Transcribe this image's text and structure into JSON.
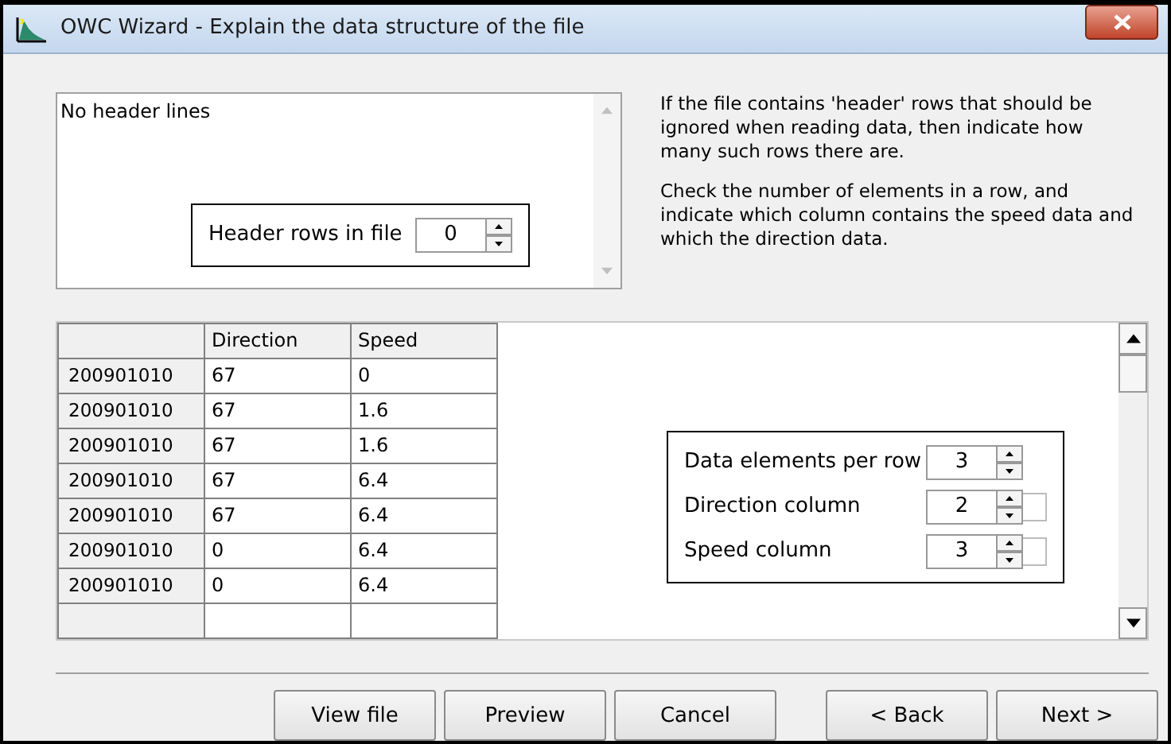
{
  "window": {
    "title": "OWC Wizard - Explain the data structure of the file"
  },
  "header_memo": {
    "text": "No header lines"
  },
  "header_rows": {
    "label": "Header rows in file",
    "value": "0"
  },
  "instructions": [
    "If the file contains 'header' rows that should be ignored when reading data, then indicate how many such rows there are.",
    "Check the number of elements in a row, and indicate which column contains the speed data and which the direction data."
  ],
  "table": {
    "columns": [
      "",
      "Direction",
      "Speed"
    ],
    "rows": [
      [
        "200901010",
        "67",
        "0"
      ],
      [
        "200901010",
        "67",
        "1.6"
      ],
      [
        "200901010",
        "67",
        "1.6"
      ],
      [
        "200901010",
        "67",
        "6.4"
      ],
      [
        "200901010",
        "67",
        "6.4"
      ],
      [
        "200901010",
        "0",
        "6.4"
      ],
      [
        "200901010",
        "0",
        "6.4"
      ]
    ]
  },
  "columns_settings": [
    {
      "label": "Data elements per row",
      "value": "3",
      "kind": "plain"
    },
    {
      "label": "Direction column",
      "value": "2",
      "kind": "boxed"
    },
    {
      "label": "Speed column",
      "value": "3",
      "kind": "boxed"
    }
  ],
  "buttons": [
    "View file",
    "Preview",
    "Cancel",
    "< Back",
    "Next >"
  ]
}
